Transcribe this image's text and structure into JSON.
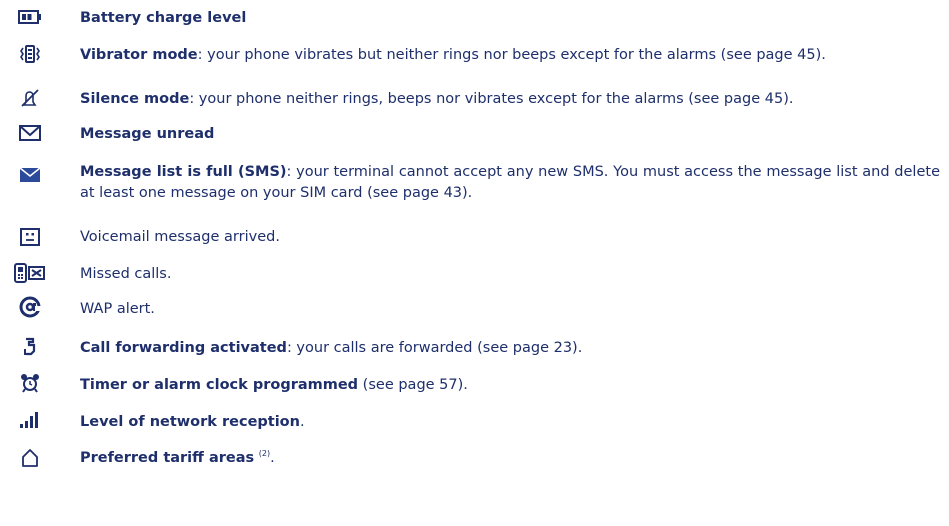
{
  "entries": [
    {
      "icon": "battery-icon",
      "title": "Battery charge level",
      "rest": ""
    },
    {
      "icon": "vibrate-icon",
      "title": "Vibrator mode",
      "rest": ": your phone vibrates but neither rings nor beeps except for the alarms (see page 45)."
    },
    {
      "icon": "silence-icon",
      "title": "Silence mode",
      "rest": ": your phone neither rings, beeps nor vibrates except for the alarms (see page 45)."
    },
    {
      "icon": "envelope-outline-icon",
      "title": "Message unread",
      "rest": ""
    },
    {
      "icon": "envelope-filled-icon",
      "title": "Message list is full (SMS)",
      "rest": ": your terminal cannot accept any new SMS. You must access the message list and delete at least one message on your SIM card (see page 43)."
    },
    {
      "icon": "voicemail-icon",
      "title": "",
      "rest": "Voicemail message arrived."
    },
    {
      "icon": "missed-call-icon",
      "title": "",
      "rest": "Missed calls."
    },
    {
      "icon": "at-sign-icon",
      "title": "",
      "rest": "WAP alert."
    },
    {
      "icon": "call-forward-icon",
      "title": "Call forwarding activated",
      "rest": ": your calls are forwarded (see page 23)."
    },
    {
      "icon": "alarm-clock-icon",
      "title": "Timer or alarm clock programmed",
      "rest": " (see page 57)."
    },
    {
      "icon": "signal-icon",
      "title": "Level of network reception",
      "rest": "."
    },
    {
      "icon": "home-icon",
      "title": "Preferred tariff areas",
      "sup": "(2)",
      "rest": "."
    }
  ]
}
